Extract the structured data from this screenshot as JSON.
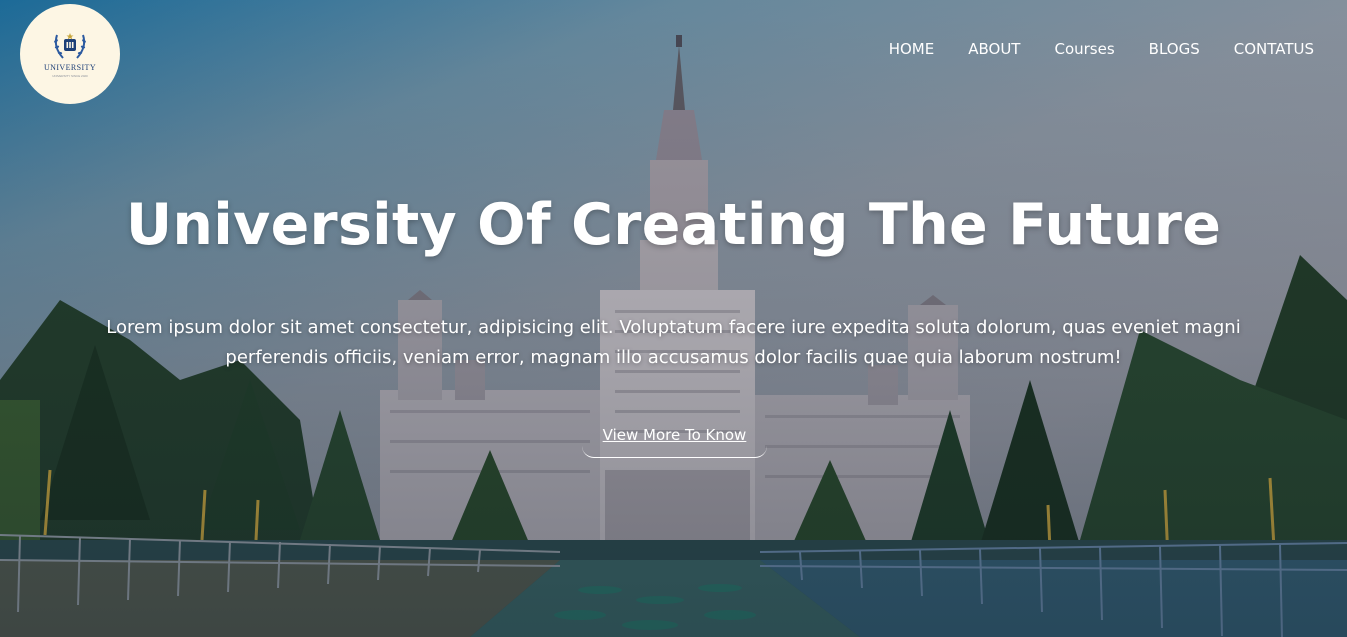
{
  "logo": {
    "name": "UNIVERSITY",
    "tagline": "UNIVERSITY SINCE 2020"
  },
  "nav": {
    "items": [
      {
        "label": "HOME"
      },
      {
        "label": "ABOUT"
      },
      {
        "label": "Courses"
      },
      {
        "label": "BLOGS"
      },
      {
        "label": "CONTATUS"
      }
    ]
  },
  "hero": {
    "title": "University Of Creating The Future",
    "description": "Lorem ipsum dolor sit amet consectetur, adipisicing elit. Voluptatum facere iure expedita soluta dolorum, quas eveniet magni perferendis officiis, veniam error, magnam illo accusamus dolor facilis quae quia laborum nostrum!",
    "cta_label": "View More To Know"
  },
  "colors": {
    "logo_background": "#fdf6e4",
    "logo_ink": "#1d3f77",
    "text": "#ffffff"
  }
}
